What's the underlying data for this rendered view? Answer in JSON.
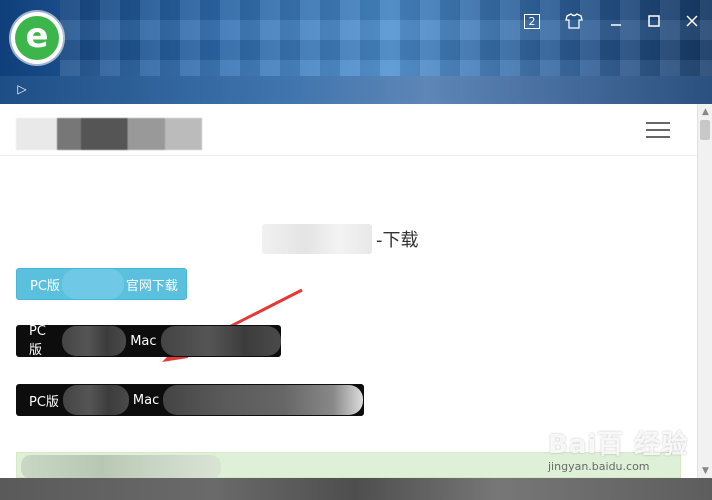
{
  "browser": {
    "badge_count": "2",
    "skin_icon": "tshirt-icon",
    "minimize_icon": "minimize-icon",
    "maximize_icon": "maximize-icon",
    "close_icon": "close-icon",
    "logo_letter": "e",
    "logo_color": "#3cb54a",
    "play_icon": "▷"
  },
  "page": {
    "heading_suffix": "-下载",
    "buttons": {
      "official": {
        "prefix": "PC版",
        "suffix": "官网下载",
        "color": "#5bc0de"
      },
      "pc_mac_1": {
        "prefix": "PC版",
        "mac": "Mac",
        "color": "#0d0d0d"
      },
      "pc_mac_2": {
        "prefix": "PC版",
        "mac": "Mac",
        "color": "#0d0d0d"
      }
    },
    "notice_color": "#dff0d8",
    "arrow_color": "#e53935"
  },
  "watermark": {
    "logo": "Bai百 经验",
    "site": "jingyan.baidu.com"
  }
}
